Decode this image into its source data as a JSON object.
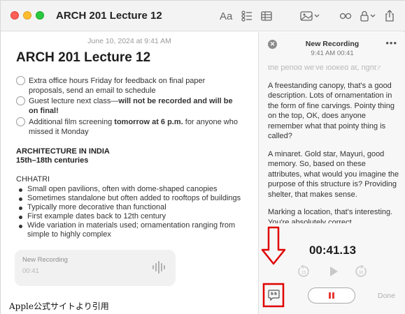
{
  "window": {
    "title": "ARCH 201 Lecture 12"
  },
  "toolbar": {
    "icons": [
      "format-text-icon",
      "checklist-icon",
      "table-icon",
      "media-icon",
      "collaborate-icon",
      "lock-icon",
      "share-icon"
    ],
    "format_label": "Aa"
  },
  "note": {
    "date": "June 10, 2024 at 9:41 AM",
    "title": "ARCH 201 Lecture 12",
    "checklist": [
      {
        "text": "Extra office hours Friday for feedback on final paper proposals, send an email to schedule"
      },
      {
        "text_pre": "Guest lecture next class—",
        "text_bold": "will not be recorded and will be on final!"
      },
      {
        "text_pre": "Additional film screening ",
        "text_bold": "tomorrow at 6 p.m.",
        "text_post": " for anyone who missed it Monday"
      }
    ],
    "section_heading": "ARCHITECTURE IN INDIA",
    "section_subheading": "15th–18th centuries",
    "subsection": "CHHATRI",
    "bullets": [
      "Small open pavilions, often with dome-shaped canopies",
      "Sometimes standalone but often added to rooftops of buildings",
      "Typically more decorative than functional",
      "First example dates back to 12th century",
      "Wide variation in materials used; ornamentation ranging from simple to highly complex"
    ],
    "recording_card": {
      "title": "New Recording",
      "time": "00:41"
    }
  },
  "side": {
    "title": "New Recording",
    "subtitle": "9:41 AM  00:41",
    "transcript": [
      "the period we've looked at, right?",
      "A freestanding canopy, that's a good description. Lots of ornamentation in the form of fine carvings. Pointy thing on the top, OK, does anyone remember what that pointy thing is called?",
      "A minaret. Gold star, Mayuri, good memory. So, based on these attributes, what would you imagine the purpose of this structure is? Providing shelter, that makes sense.",
      "Marking a location, that's interesting. You're absolutely correct"
    ],
    "timer": "00:41.13",
    "skip_back": "15",
    "skip_forward": "30",
    "done_label": "Done"
  },
  "caption": "Apple公式サイトより引用",
  "colors": {
    "accent_red": "#e53935",
    "annotation_red": "#e00000"
  }
}
